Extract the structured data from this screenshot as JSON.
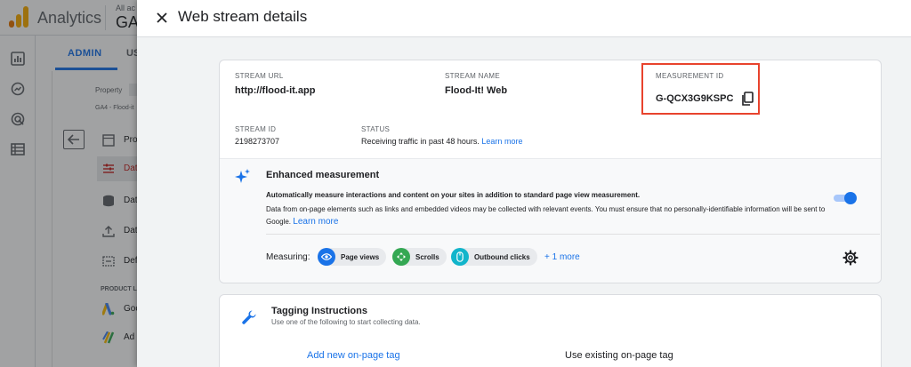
{
  "background_app": {
    "app_name": "Analytics",
    "account_small": "All ac",
    "account_big": "GA4",
    "tabs": {
      "admin": "ADMIN",
      "user": "US"
    },
    "property_label": "Property",
    "property_name": "GA4 - Flood-it",
    "nav_items": [
      {
        "label": "Pro",
        "icon": "property-icon"
      },
      {
        "label": "Dat",
        "icon": "data-streams-icon",
        "active": true
      },
      {
        "label": "Dat",
        "icon": "database-icon"
      },
      {
        "label": "Dat",
        "icon": "upload-icon"
      },
      {
        "label": "Def",
        "icon": "definitions-icon"
      }
    ],
    "product_links_heading": "PRODUCT L",
    "product_items": [
      {
        "label": "Goo",
        "icon": "google-ads-icon"
      },
      {
        "label": "Ad l",
        "icon": "ad-manager-icon"
      }
    ]
  },
  "panel": {
    "title": "Web stream details",
    "stream_url": {
      "label": "STREAM URL",
      "value": "http://flood-it.app"
    },
    "stream_name": {
      "label": "STREAM NAME",
      "value": "Flood-It! Web"
    },
    "measurement_id": {
      "label": "MEASUREMENT ID",
      "value": "G-QCX3G9KSPC"
    },
    "stream_id": {
      "label": "STREAM ID",
      "value": "2198273707"
    },
    "status": {
      "label": "STATUS",
      "value": "Receiving traffic in past 48 hours.",
      "link": "Learn more"
    },
    "enhanced": {
      "title": "Enhanced measurement",
      "desc_bold": "Automatically measure interactions and content on your sites in addition to standard page view measurement.",
      "desc": "Data from on-page elements such as links and embedded videos may be collected with relevant events. You must ensure that no personally-identifiable information will be sent to Google.",
      "desc_link": "Learn more",
      "toggle_on": true,
      "measuring_label": "Measuring:",
      "chips": [
        {
          "label": "Page views",
          "icon": "eye-icon",
          "color": "#1a73e8"
        },
        {
          "label": "Scrolls",
          "icon": "scroll-icon",
          "color": "#34a853"
        },
        {
          "label": "Outbound clicks",
          "icon": "mouse-icon",
          "color": "#12b5cb"
        }
      ],
      "more": "+ 1 more"
    },
    "tagging": {
      "title": "Tagging Instructions",
      "subtitle": "Use one of the following to start collecting data.",
      "option_new": "Add new on-page tag",
      "option_existing": "Use existing on-page tag"
    }
  },
  "colors": {
    "accent": "#1a73e8",
    "highlight_box": "#e8432d",
    "active_nav_text": "#c5221f"
  }
}
